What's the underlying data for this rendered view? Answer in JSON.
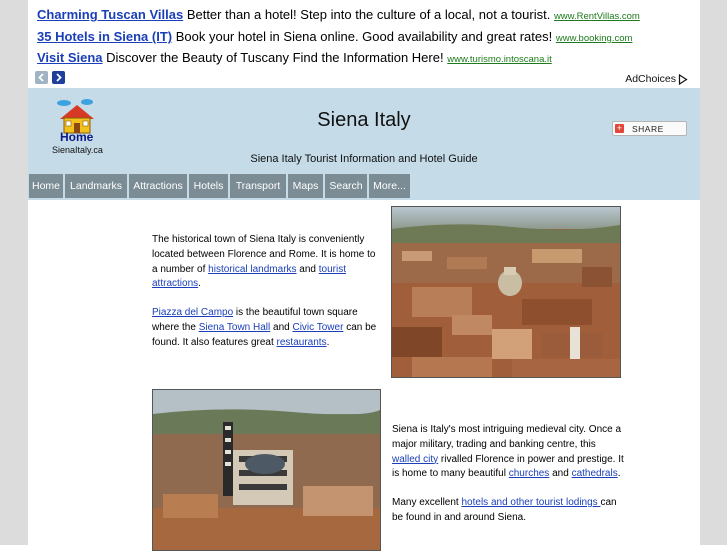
{
  "ads": {
    "items": [
      {
        "title": "Charming Tuscan Villas",
        "text": "Better than a hotel! Step into the culture of a local, not a tourist.",
        "url": "www.RentVillas.com"
      },
      {
        "title": "35 Hotels in Siena (IT)",
        "text": "Book your hotel in Siena online. Good availability and great rates!",
        "url": "www.booking.com"
      },
      {
        "title": "Visit Siena",
        "text": "Discover the Beauty of Tuscany Find the Information Here!",
        "url": "www.turismo.intoscana.it"
      }
    ],
    "adchoices_label": "AdChoices"
  },
  "header": {
    "home_label": "Home",
    "domain_label": "SienaItaly.ca",
    "title": "Siena Italy",
    "subtitle": "Siena Italy Tourist Information and Hotel Guide",
    "share_label": "SHARE"
  },
  "nav": {
    "items": [
      "Home",
      "Landmarks",
      "Attractions",
      "Hotels",
      "Transport",
      "Maps",
      "Search",
      "More..."
    ]
  },
  "content": {
    "p1": {
      "t1": "The historical town of Siena Italy is conveniently located between Florence and Rome. It is home to a number of ",
      "l1": "historical landmarks",
      "t2": " and ",
      "l2": "tourist attractions",
      "t3": "."
    },
    "p2": {
      "l1": "Piazza del Campo",
      "t1": " is the beautiful town square where the ",
      "l2": "Siena Town Hall",
      "t2": " and ",
      "l3": "Civic Tower",
      "t3": " can be found.  It also features great ",
      "l4": "restaurants",
      "t4": "."
    },
    "p3": {
      "t1": "Siena is Italy's most intriguing medieval city.  Once a major military, trading and banking centre, this ",
      "l1": "walled city",
      "t2": " rivalled Florence in power and prestige. It is home to many beautiful ",
      "l2": "churches",
      "t3": " and ",
      "l3": "cathedrals",
      "t4": "."
    },
    "p4": {
      "t1": "Many excellent ",
      "l1": "hotels and other tourist lodings ",
      "t2": "can be found in and around Siena."
    }
  },
  "colors": {
    "header_bg": "#c5dbe8",
    "nav_bg": "#7b8c94",
    "link": "#1a3fb8",
    "ad_url": "#1d7a1d",
    "page_side": "#dcdcdc"
  },
  "icons": [
    "house-logo-icon",
    "chevron-left-icon",
    "chevron-right-icon",
    "adchoices-icon",
    "share-plus-icon"
  ]
}
